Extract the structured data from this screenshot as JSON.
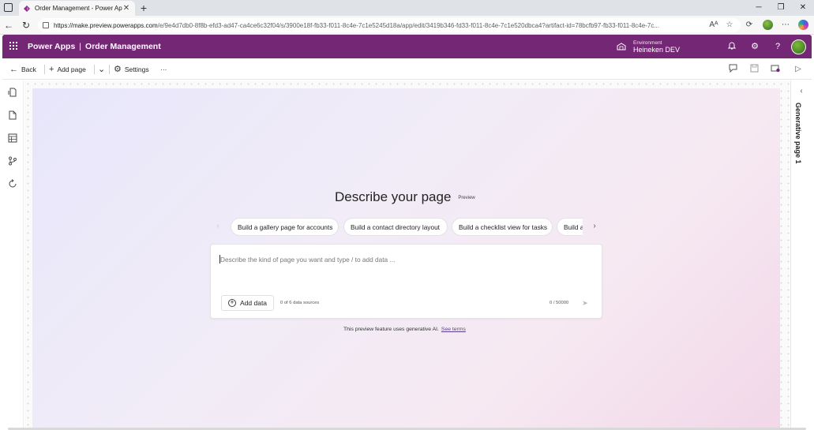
{
  "browser": {
    "tab_title": "Order Management - Power Apps",
    "new_tab": "+",
    "close_tab": "✕",
    "url_host": "https://make.preview.powerapps.com",
    "url_path": "/e/9e4d7db0-8f8b-efd3-ad47-ca4ce6c32f04/s/3900e18f-fb33-f011-8c4e-7c1e5245d18a/app/edit/3419b346-fd33-f011-8c4e-7c1e520dbca4?artifact-id=78bcfb97-fb33-f011-8c4e-7c..."
  },
  "header": {
    "app_name": "Power Apps",
    "separator": "|",
    "project_name": "Order Management",
    "environment_label": "Environment",
    "environment_name": "Heineken DEV",
    "brand_color": "#742774"
  },
  "commandbar": {
    "back": "Back",
    "add_page": "Add page",
    "settings": "Settings",
    "more": "···"
  },
  "canvas": {
    "heading": "Describe your page",
    "badge": "Preview",
    "suggestions": [
      "Build a gallery page for accounts",
      "Build a contact directory layout",
      "Build a checklist view for tasks",
      "Build a"
    ],
    "prompt_placeholder": "Describe the kind of page you want and type / to add data ...",
    "add_data": "Add data",
    "data_sources": "0 of 6 data sources",
    "char_count": "0 / 50000",
    "disclaimer": "This preview feature uses generative AI.",
    "see_terms": "See terms"
  },
  "right_pane": {
    "label": "Generative page 1"
  }
}
